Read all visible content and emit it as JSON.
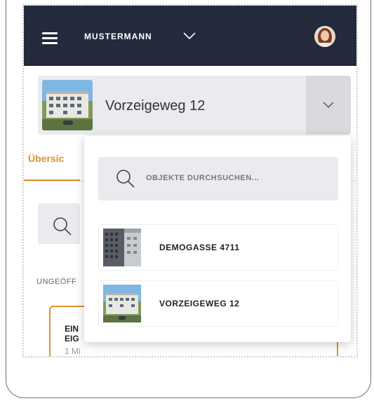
{
  "header": {
    "user_name": "MUSTERMANN",
    "menu_icon": "hamburger-icon",
    "chevron_icon": "chevron-down-icon",
    "background_color": "#222a3c"
  },
  "selector": {
    "current_property": "Vorzeigeweg 12",
    "toggle_icon": "chevron-down-icon"
  },
  "background": {
    "tab_label": "Übersic",
    "section_label": "UNGEÖFF",
    "card_title": "EIN EIG",
    "card_subtitle": "1 Mi",
    "accent_color": "#e0912a"
  },
  "dropdown": {
    "search_placeholder": "OBJEKTE DURCHSUCHEN...",
    "items": [
      {
        "label": "DEMOGASSE 4711"
      },
      {
        "label": "VORZEIGEWEG 12"
      }
    ]
  }
}
